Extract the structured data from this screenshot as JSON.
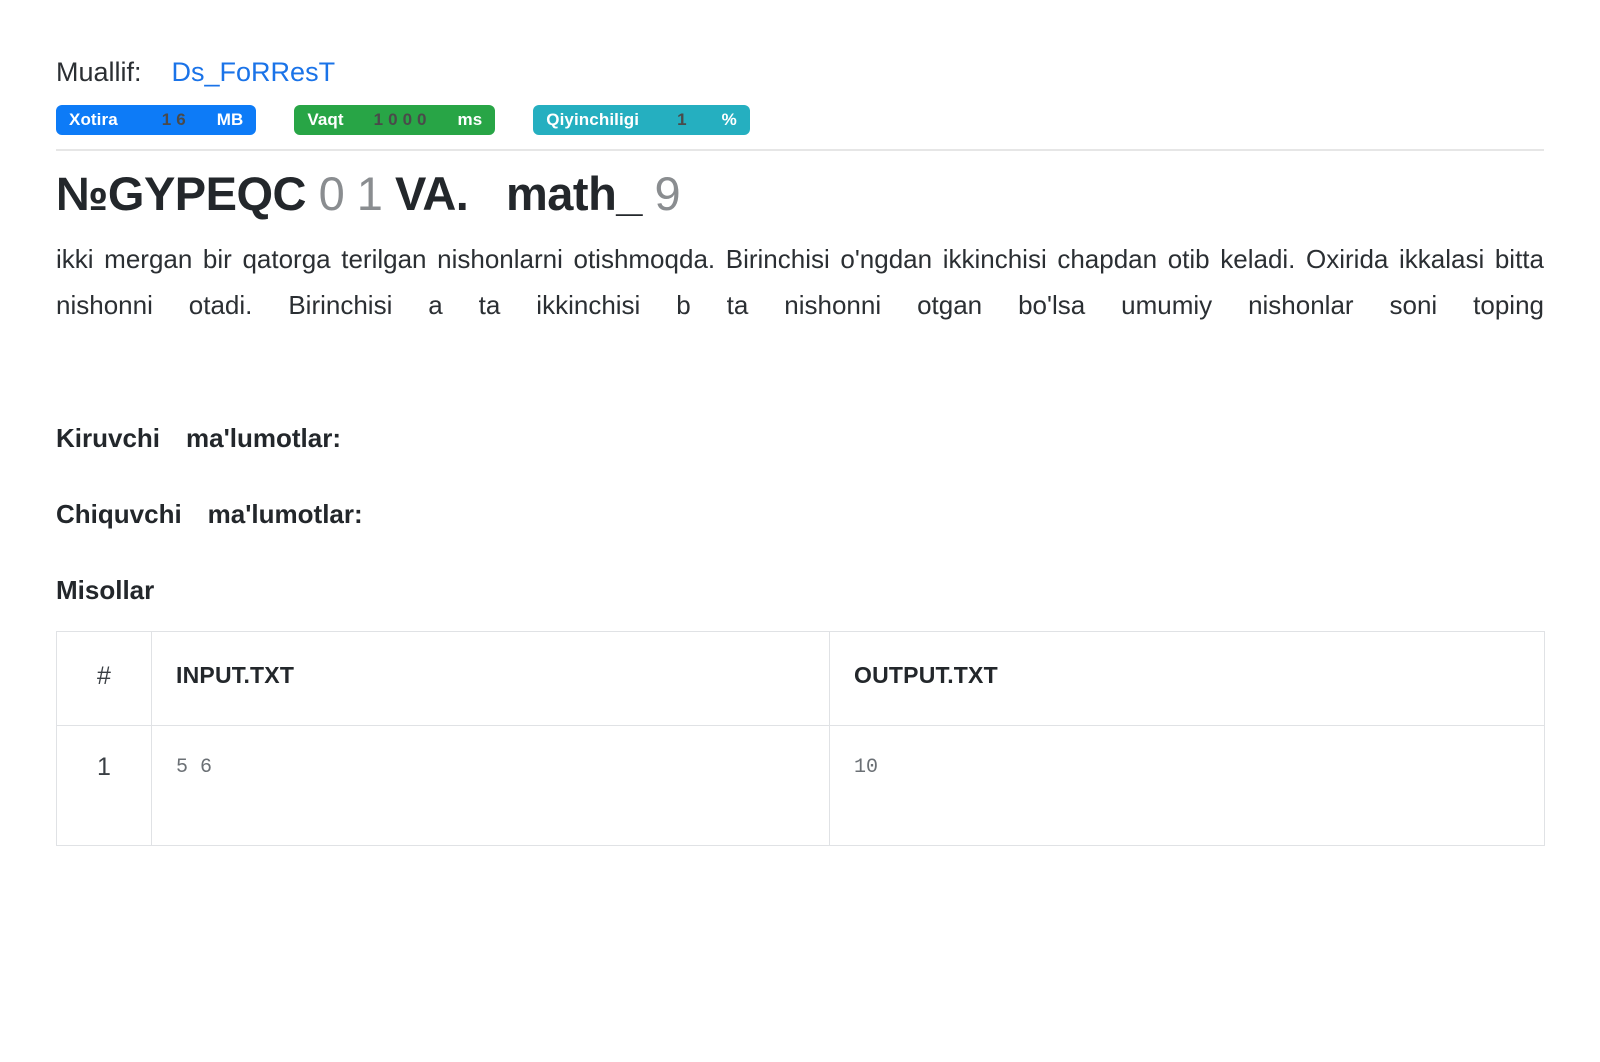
{
  "author": {
    "label": "Muallif:",
    "name": "Ds_FoRResT",
    "link_color": "#1a73e8"
  },
  "badges": [
    {
      "name": "memory",
      "key": "Xotira",
      "value": "16",
      "unit": "MB",
      "color": "#0d7bf7"
    },
    {
      "name": "time",
      "key": "Vaqt",
      "value": "1000",
      "unit": "ms",
      "color": "#28a546"
    },
    {
      "name": "difficulty",
      "key": "Qiyinchiligi",
      "value": "1",
      "unit": "%",
      "color": "#25afc0"
    }
  ],
  "title": {
    "part1": "№GYPEQC ",
    "dim1": "0",
    "part2": " ",
    "dim2": "1",
    "part3": " VA.   math_ ",
    "dim3": "9",
    "full": "№GYPEQC 0 1 VA.   math_ 9"
  },
  "description": "ikki mergan bir qatorga terilgan nishonlarni otishmoqda. Birinchisi o'ngdan ikkinchisi chapdan otib keladi. Oxirida ikkalasi bitta nishonni otadi. Birinchisi a ta ikkinchisi b ta nishonni otgan bo'lsa umumiy nishonlar soni toping",
  "sections": {
    "input_heading_a": "Kiruvchi",
    "input_heading_b": "ma'lumotlar:",
    "output_heading_a": "Chiquvchi",
    "output_heading_b": "ma'lumotlar:",
    "examples_heading": "Misollar"
  },
  "examples_table": {
    "headers": {
      "num": "#",
      "input": "INPUT.TXT",
      "output": "OUTPUT.TXT"
    },
    "rows": [
      {
        "num": "1",
        "input": "5 6",
        "output": "10"
      }
    ]
  }
}
